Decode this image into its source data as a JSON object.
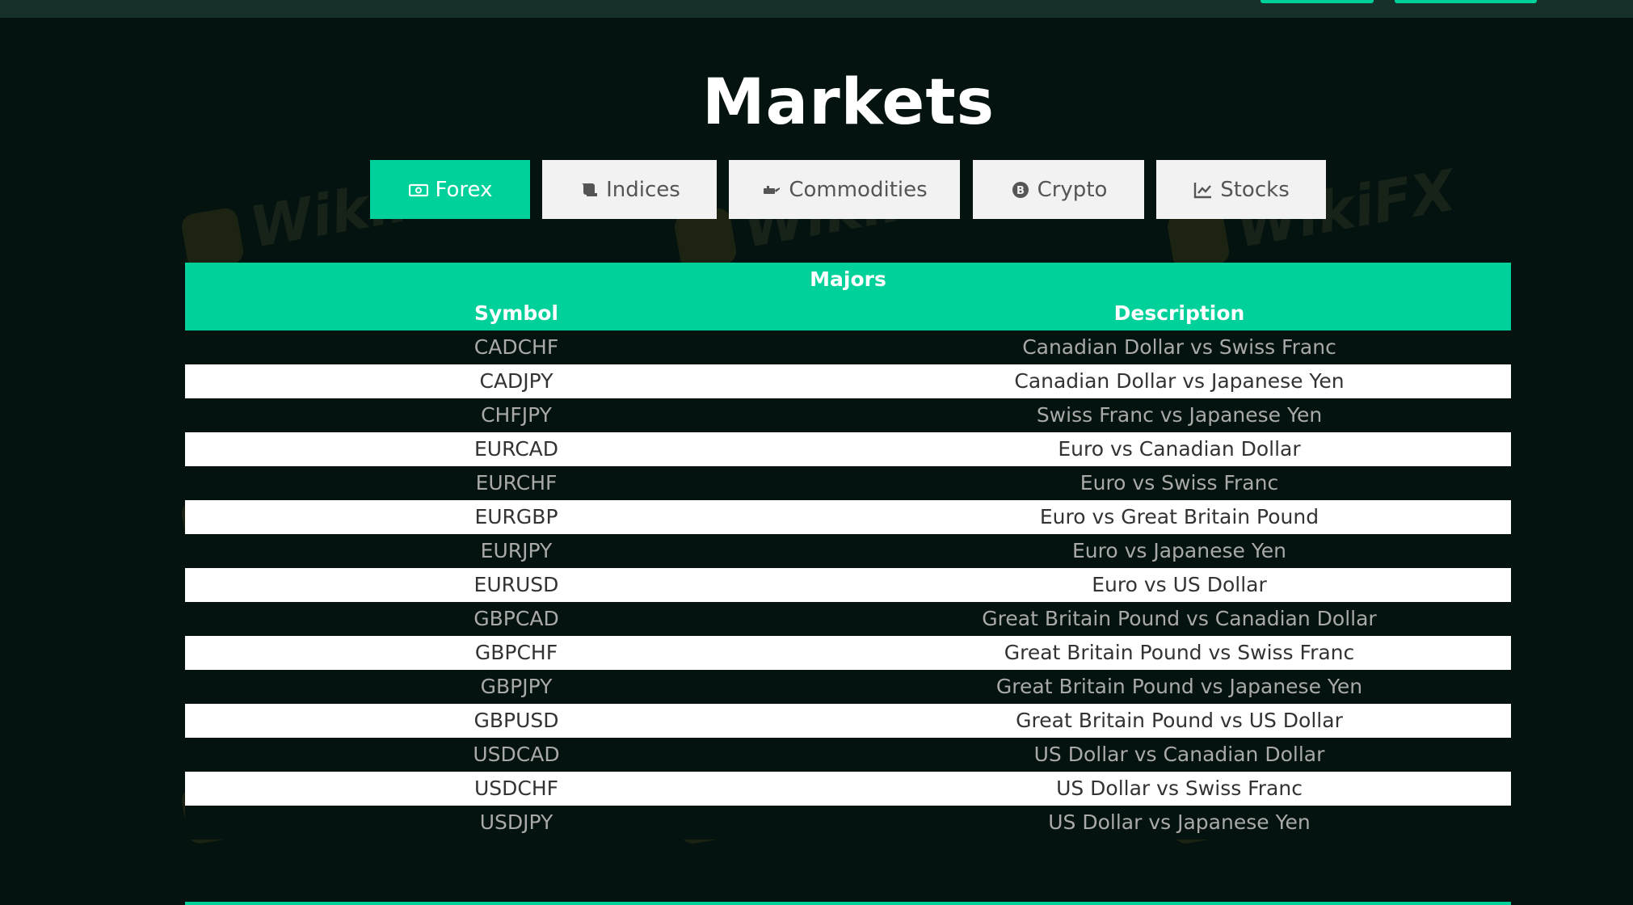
{
  "page": {
    "title": "Markets"
  },
  "tabs": [
    {
      "label": "Forex",
      "icon": "money-bill-icon",
      "active": true
    },
    {
      "label": "Indices",
      "icon": "scroll-icon",
      "active": false
    },
    {
      "label": "Commodities",
      "icon": "oil-can-icon",
      "active": false
    },
    {
      "label": "Crypto",
      "icon": "bitcoin-icon",
      "active": false
    },
    {
      "label": "Stocks",
      "icon": "chart-line-icon",
      "active": false
    }
  ],
  "table": {
    "caption": "Majors",
    "headers": {
      "symbol": "Symbol",
      "description": "Description"
    },
    "rows": [
      {
        "symbol": "CADCHF",
        "description": "Canadian Dollar vs Swiss Franc"
      },
      {
        "symbol": "CADJPY",
        "description": "Canadian Dollar vs Japanese Yen"
      },
      {
        "symbol": "CHFJPY",
        "description": "Swiss Franc vs Japanese Yen"
      },
      {
        "symbol": "EURCAD",
        "description": "Euro vs Canadian Dollar"
      },
      {
        "symbol": "EURCHF",
        "description": "Euro vs Swiss Franc"
      },
      {
        "symbol": "EURGBP",
        "description": "Euro vs Great Britain Pound"
      },
      {
        "symbol": "EURJPY",
        "description": "Euro vs Japanese Yen"
      },
      {
        "symbol": "EURUSD",
        "description": "Euro vs US Dollar"
      },
      {
        "symbol": "GBPCAD",
        "description": "Great Britain Pound vs Canadian Dollar"
      },
      {
        "symbol": "GBPCHF",
        "description": "Great Britain Pound vs Swiss Franc"
      },
      {
        "symbol": "GBPJPY",
        "description": "Great Britain Pound vs Japanese Yen"
      },
      {
        "symbol": "GBPUSD",
        "description": "Great Britain Pound vs US Dollar"
      },
      {
        "symbol": "USDCAD",
        "description": "US Dollar vs Canadian Dollar"
      },
      {
        "symbol": "USDCHF",
        "description": "US Dollar vs Swiss Franc"
      },
      {
        "symbol": "USDJPY",
        "description": "US Dollar vs Japanese Yen"
      }
    ]
  },
  "watermark": {
    "text": "WikiFX"
  },
  "colors": {
    "accent": "#00d19a",
    "background": "#04130f",
    "topbar": "#17302a"
  }
}
